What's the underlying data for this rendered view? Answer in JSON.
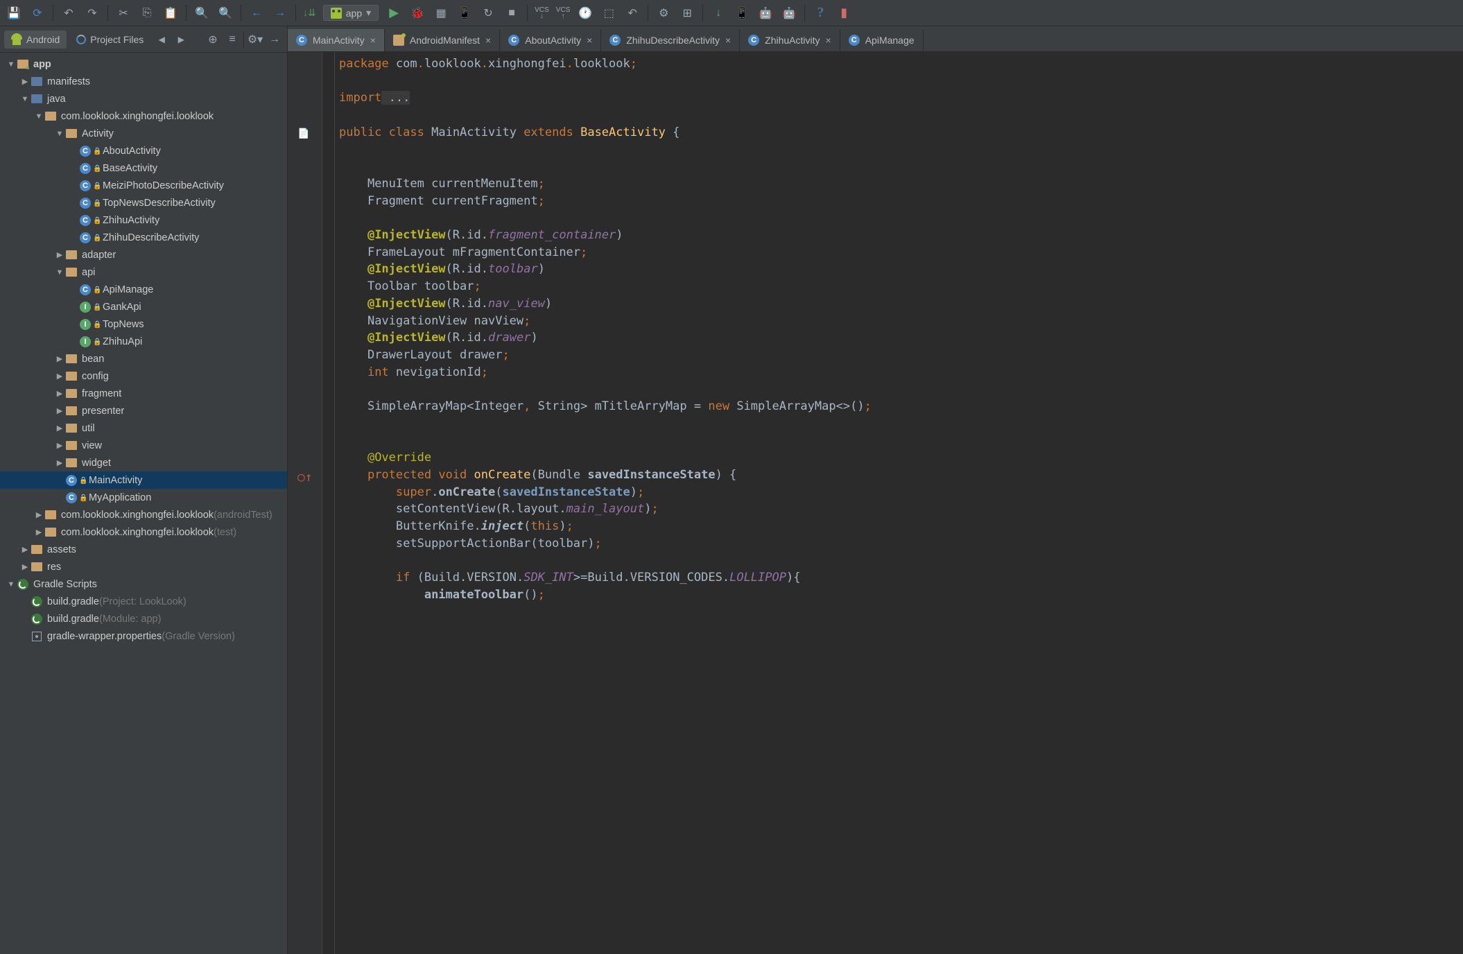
{
  "toolbar": {
    "run_config": "app"
  },
  "sidebar_tabs": {
    "android": "Android",
    "project_files": "Project Files"
  },
  "tree": {
    "root": "app",
    "manifests": "manifests",
    "java": "java",
    "pkg_main": "com.looklook.xinghongfei.looklook",
    "activity_folder": "Activity",
    "activities": [
      "AboutActivity",
      "BaseActivity",
      "MeiziPhotoDescribeActivity",
      "TopNewsDescribeActivity",
      "ZhihuActivity",
      "ZhihuDescribeActivity"
    ],
    "adapter": "adapter",
    "api": "api",
    "api_items": [
      {
        "name": "ApiManage",
        "kind": "C"
      },
      {
        "name": "GankApi",
        "kind": "I"
      },
      {
        "name": "TopNews",
        "kind": "I"
      },
      {
        "name": "ZhihuApi",
        "kind": "I"
      }
    ],
    "folders2": [
      "bean",
      "config",
      "fragment",
      "presenter",
      "util",
      "view",
      "widget"
    ],
    "main_activity": "MainActivity",
    "my_application": "MyApplication",
    "pkg_android_test": "com.looklook.xinghongfei.looklook",
    "pkg_android_test_suffix": " (androidTest)",
    "pkg_test": "com.looklook.xinghongfei.looklook",
    "pkg_test_suffix": " (test)",
    "assets": "assets",
    "res": "res",
    "gradle_scripts": "Gradle Scripts",
    "build_gradle_1": "build.gradle",
    "build_gradle_1_suffix": " (Project: LookLook)",
    "build_gradle_2": "build.gradle",
    "build_gradle_2_suffix": " (Module: app)",
    "gradle_wrapper": "gradle-wrapper.properties",
    "gradle_wrapper_suffix": " (Gradle Version)"
  },
  "editor_tabs": [
    "MainActivity",
    "AndroidManifest",
    "AboutActivity",
    "ZhihuDescribeActivity",
    "ZhihuActivity",
    "ApiManage"
  ],
  "code": {
    "l1_package": "package",
    "l1_pkg": " com",
    "l1_dot": ".",
    "l1_p2": "looklook",
    "l1_p3": "xinghongfei",
    "l1_p4": "looklook",
    "import": "import",
    "import_dots": " ...",
    "public": "public",
    "class_kw": "class",
    "main_activity": "MainActivity",
    "extends": "extends",
    "base_activity": "BaseActivity",
    "menuitem_t": "MenuItem",
    "menuitem_n": "currentMenuItem",
    "fragment_t": "Fragment",
    "fragment_n": "currentFragment",
    "inject": "@InjectView",
    "r": "R",
    "id_kw": "id",
    "frag_cont": "fragment_container",
    "framel_t": "FrameLayout",
    "framel_n": "mFragmentContainer",
    "toolbar_id": "toolbar",
    "toolbar_t": "Toolbar",
    "toolbar_n": "toolbar",
    "nav_id": "nav_view",
    "nav_t": "NavigationView",
    "nav_n": "navView",
    "drawer_id": "drawer",
    "drawer_t": "DrawerLayout",
    "drawer_n": "drawer",
    "int_kw": "int",
    "nevid": "nevigationId",
    "sam": "SimpleArrayMap",
    "integer": "Integer",
    "string": "String",
    "mtitle": "mTitleArryMap",
    "new_kw": "new",
    "override": "@Override",
    "protected": "protected",
    "void": "void",
    "oncreate": "onCreate",
    "bundle": "Bundle",
    "sis": "savedInstanceState",
    "super": "super",
    "oncreate_call": "onCreate",
    "sis2": "savedInstanceState",
    "setcontent": "setContentView",
    "layout": "layout",
    "main_layout": "main_layout",
    "butter": "ButterKnife",
    "inject_m": "inject",
    "this": "this",
    "setsupport": "setSupportActionBar",
    "toolbar_arg": "toolbar",
    "if": "if",
    "build": "Build",
    "version": "VERSION",
    "sdkint": "SDK_INT",
    "version_codes": "VERSION_CODES",
    "lollipop": "LOLLIPOP",
    "animtb": "animateToolbar"
  }
}
